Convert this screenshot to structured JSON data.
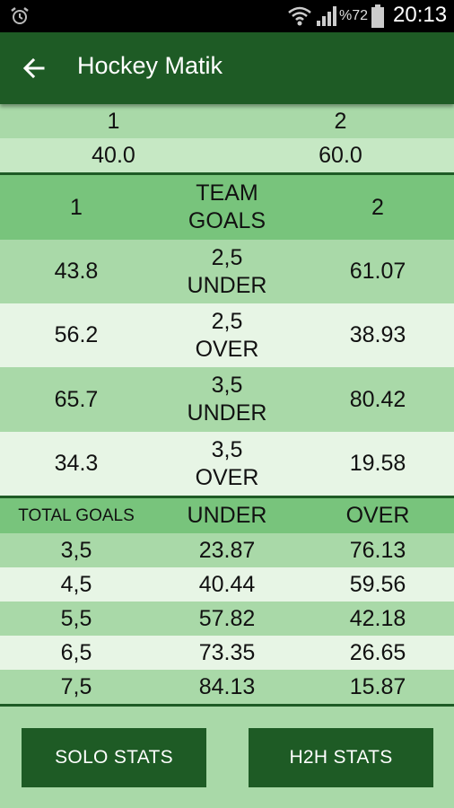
{
  "status_bar": {
    "battery_percent": "%72",
    "time": "20:13",
    "icons": [
      "alarm-icon",
      "wifi-icon",
      "signal-icon",
      "battery-icon"
    ]
  },
  "app_bar": {
    "title": "Hockey Matik",
    "back_icon": "arrow-left-icon"
  },
  "colors": {
    "primary": "#1e5b25",
    "row_dark": "#a9d9a8",
    "row_light": "#e7f5e5",
    "header": "#78c47c",
    "row_mid": "#c6e8c4"
  },
  "team_header": {
    "team1": "1",
    "team2": "2"
  },
  "team_odds": {
    "team1": "40.0",
    "team2": "60.0"
  },
  "team_goals": {
    "header": {
      "col1": "1",
      "col2_line1": "TEAM",
      "col2_line2": "GOALS",
      "col3": "2"
    },
    "rows": [
      {
        "team1": "43.8",
        "line": "2,5",
        "type": "UNDER",
        "team2": "61.07"
      },
      {
        "team1": "56.2",
        "line": "2,5",
        "type": "OVER",
        "team2": "38.93"
      },
      {
        "team1": "65.7",
        "line": "3,5",
        "type": "UNDER",
        "team2": "80.42"
      },
      {
        "team1": "34.3",
        "line": "3,5",
        "type": "OVER",
        "team2": "19.58"
      }
    ]
  },
  "total_goals": {
    "header": {
      "col1": "TOTAL GOALS",
      "col2": "UNDER",
      "col3": "OVER"
    },
    "rows": [
      {
        "line": "3,5",
        "under": "23.87",
        "over": "76.13"
      },
      {
        "line": "4,5",
        "under": "40.44",
        "over": "59.56"
      },
      {
        "line": "5,5",
        "under": "57.82",
        "over": "42.18"
      },
      {
        "line": "6,5",
        "under": "73.35",
        "over": "26.65"
      },
      {
        "line": "7,5",
        "under": "84.13",
        "over": "15.87"
      }
    ]
  },
  "buttons": {
    "solo": "SOLO STATS",
    "h2h": "H2H STATS"
  }
}
